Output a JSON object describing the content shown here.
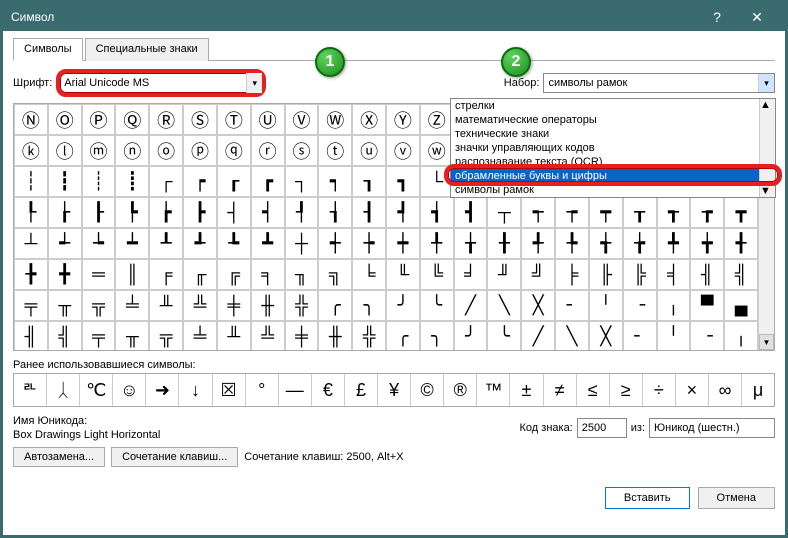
{
  "titlebar": {
    "title": "Символ"
  },
  "tabs": {
    "symbols": "Символы",
    "special": "Специальные знаки"
  },
  "labels": {
    "font": "Шрифт:",
    "set": "Набор:",
    "recent": "Ранее использовавшиеся символы:",
    "unicode_name": "Имя Юникода:",
    "char_code": "Код знака:",
    "from": "из:",
    "shortcut": "Сочетание клавиш: 2500, Alt+X"
  },
  "values": {
    "font": "Arial Unicode MS",
    "set": "символы рамок",
    "unicode_name": "Box Drawings Light Horizontal",
    "char_code": "2500",
    "from": "Юникод (шестн.)"
  },
  "buttons": {
    "autocorrect": "Автозамена...",
    "shortcut_btn": "Сочетание клавиш...",
    "insert": "Вставить",
    "cancel": "Отмена"
  },
  "set_options": [
    "стрелки",
    "математические операторы",
    "технические знаки",
    "значки управляющих кодов",
    "распознавание текста (OCR)",
    "обрамленные буквы и цифры",
    "символы рамок"
  ],
  "set_selected_index": 5,
  "badges": {
    "one": "1",
    "two": "2"
  },
  "grid_chars": [
    "Ⓝ",
    "Ⓞ",
    "Ⓟ",
    "Ⓠ",
    "Ⓡ",
    "Ⓢ",
    "Ⓣ",
    "Ⓤ",
    "Ⓥ",
    "Ⓦ",
    "Ⓧ",
    "Ⓨ",
    "Ⓩ",
    "",
    "",
    "",
    "",
    "",
    "",
    "",
    "",
    "",
    "ⓚ",
    "ⓛ",
    "ⓜ",
    "ⓝ",
    "ⓞ",
    "ⓟ",
    "ⓠ",
    "ⓡ",
    "ⓢ",
    "ⓣ",
    "ⓤ",
    "ⓥ",
    "ⓦ",
    "",
    "",
    "",
    "",
    "",
    "",
    "",
    "",
    "",
    "┆",
    "┇",
    "┊",
    "┋",
    "┌",
    "┍",
    "┎",
    "┏",
    "┐",
    "┑",
    "┒",
    "┓",
    "└",
    "┕",
    "┖",
    "┗",
    "┘",
    "┙",
    "┚",
    "┛",
    "├",
    "┝",
    "┞",
    "┟",
    "┠",
    "┡",
    "┢",
    "┣",
    "┤",
    "┥",
    "┦",
    "┧",
    "┨",
    "┩",
    "┪",
    "┫",
    "┬",
    "┭",
    "┮",
    "┯",
    "┰",
    "┱",
    "┲",
    "┳",
    "┴",
    "┵",
    "┶",
    "┷",
    "┸",
    "┹",
    "┺",
    "┻",
    "┼",
    "┽",
    "┾",
    "┿",
    "╀",
    "╁",
    "╂",
    "╃",
    "╄",
    "╅",
    "╆",
    "╇",
    "╈",
    "╉",
    "╊",
    "╋",
    "═",
    "║",
    "╒",
    "╓",
    "╔",
    "╕",
    "╖",
    "╗",
    "╘",
    "╙",
    "╚",
    "╛",
    "╜",
    "╝",
    "╞",
    "╟",
    "╠",
    "╡",
    "╢",
    "╣",
    "╤",
    "╥",
    "╦",
    "╧",
    "╨",
    "╩",
    "╪",
    "╫",
    "╬",
    "╭",
    "╮",
    "╯",
    "╰",
    "╱",
    "╲",
    "╳",
    "╴",
    "╵",
    "╶",
    "╷",
    "▀",
    "▄",
    "╢",
    "╣",
    "╤",
    "╥",
    "╦",
    "╧",
    "╨",
    "╩",
    "╪",
    "╫",
    "╬",
    "╭",
    "╮",
    "╯",
    "╰",
    "╱",
    "╲",
    "╳",
    "╴",
    "╵",
    "╶",
    "╷"
  ],
  "recent": [
    "ᄘ",
    "ᛸ",
    "℃",
    "☺",
    "➜",
    "↓",
    "☒",
    "°",
    "—",
    "€",
    "£",
    "¥",
    "©",
    "®",
    "™",
    "±",
    "≠",
    "≤",
    "≥",
    "÷",
    "×",
    "∞",
    "μ"
  ]
}
